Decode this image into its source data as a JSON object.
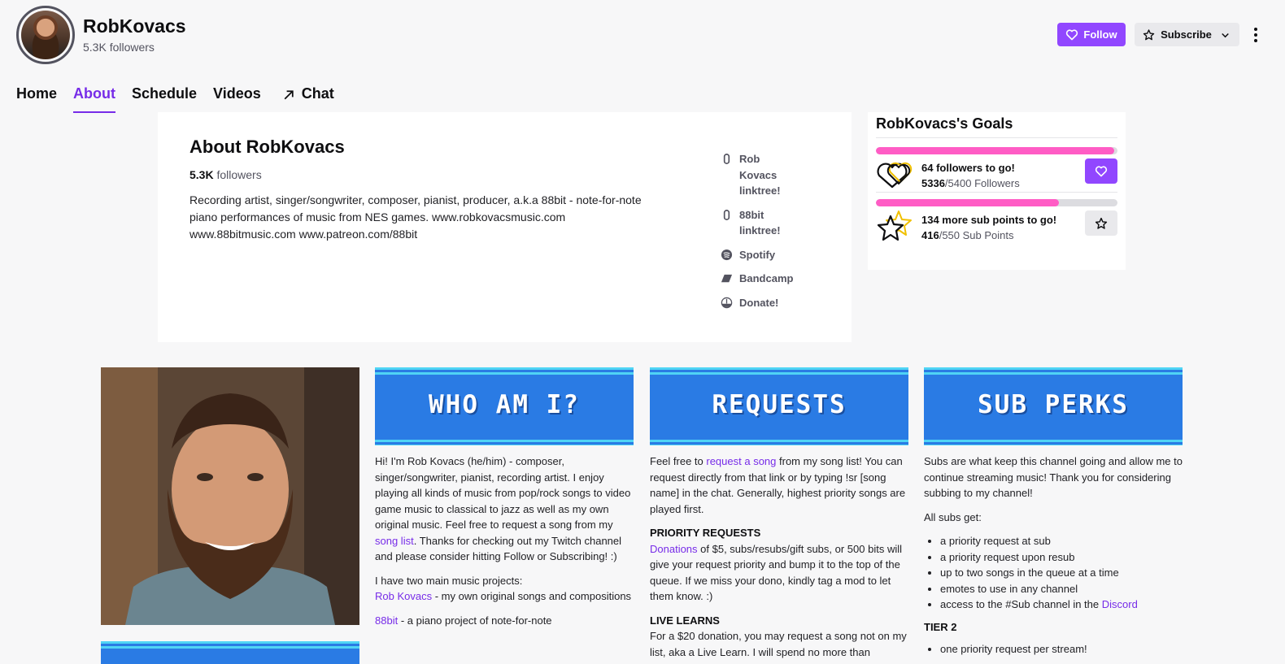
{
  "channel": {
    "name": "RobKovacs",
    "followers": "5.3K followers"
  },
  "actions": {
    "follow_label": "Follow",
    "subscribe_label": "Subscribe"
  },
  "tabs": [
    {
      "label": "Home"
    },
    {
      "label": "About"
    },
    {
      "label": "Schedule"
    },
    {
      "label": "Videos"
    },
    {
      "label": "Chat"
    }
  ],
  "about": {
    "title": "About RobKovacs",
    "followers_count": "5.3K",
    "followers_label": "followers",
    "bio": "Recording artist, singer/songwriter, composer, pianist, producer, a.k.a 88bit - note-for-note piano performances of music from NES games. www.robkovacsmusic.com www.88bitmusic.com www.patreon.com/88bit",
    "links": [
      {
        "label": "Rob Kovacs linktree!",
        "icon": "linktree-icon"
      },
      {
        "label": "88bit linktree!",
        "icon": "linktree-icon"
      },
      {
        "label": "Spotify",
        "icon": "spotify-icon"
      },
      {
        "label": "Bandcamp",
        "icon": "bandcamp-icon"
      },
      {
        "label": "Donate!",
        "icon": "donate-icon"
      }
    ]
  },
  "goals": {
    "title": "RobKovacs's Goals",
    "items": [
      {
        "headline": "64 followers to go!",
        "current": "5336",
        "rest": "/5400 Followers",
        "progress": 0.988
      },
      {
        "headline": "134 more sub points to go!",
        "current": "416",
        "rest": "/550 Sub Points",
        "progress": 0.756
      }
    ]
  },
  "panels": {
    "who": {
      "title": "WHO AM I?",
      "p1_a": "Hi! I'm Rob Kovacs (he/him) - composer, singer/songwriter, pianist, recording artist. I enjoy playing all kinds of music from pop/rock songs to video game music to classical to jazz as well as my own original music. Feel free to request a song from my ",
      "p1_link": "song list",
      "p1_b": ". Thanks for checking out my Twitch channel and please consider hitting Follow or Subscribing! :)",
      "p2": "I have two main music projects:",
      "p3_link": "Rob Kovacs",
      "p3_b": " - my own original songs and compositions",
      "p4_link": "88bit",
      "p4_b": " - a piano project of note-for-note"
    },
    "requests": {
      "title": "REQUESTS",
      "p1_a": "Feel free to ",
      "p1_link": "request a song",
      "p1_b": " from my song list! You can request directly from that link or by typing !sr [song name] in the chat. Generally, highest priority songs are played first.",
      "h1": "PRIORITY REQUESTS",
      "p2_link": "Donations",
      "p2_b": " of $5, subs/resubs/gift subs, or 500 bits will give your request priority and bump it to the top of the queue. If we miss your dono, kindly tag a mod to let them know. :)",
      "h2": "LIVE LEARNS",
      "p3": "For a $20 donation, you may request a song not on my list, aka a Live Learn. I will spend no more than"
    },
    "perks": {
      "title": "SUB PERKS",
      "p1": "Subs are what keep this channel going and allow me to continue streaming music! Thank you for considering subbing to my channel!",
      "p2": "All subs get:",
      "list": [
        "a priority request at sub",
        "a priority request upon resub",
        "up to two songs in the queue at a time",
        "emotes to use in any channel"
      ],
      "last_a": "access to the #Sub channel in the ",
      "last_link": "Discord",
      "h1": "TIER 2",
      "t2_item": "one priority request per stream!"
    }
  },
  "colors": {
    "accent": "#9147ff",
    "link": "#772ce8",
    "goal_fill": "#ff5cc5",
    "panel_blue": "#2a7be4",
    "panel_stripe": "#4fd4f5"
  }
}
